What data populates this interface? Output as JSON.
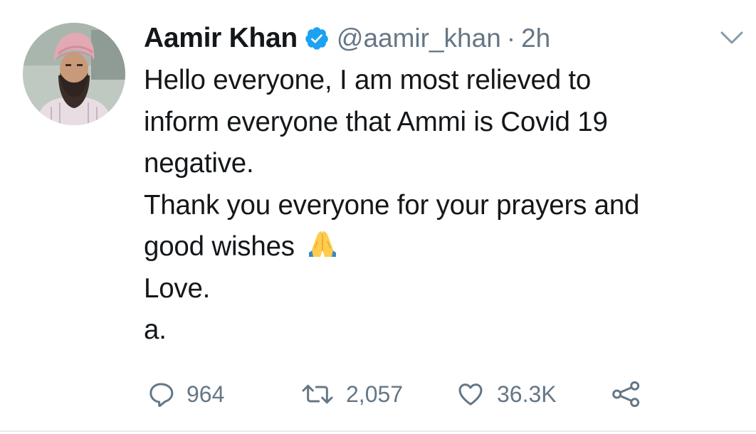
{
  "tweet": {
    "author": {
      "display_name": "Aamir Khan",
      "handle": "@aamir_khan",
      "verified": true,
      "avatar_icon": "user-avatar-photo"
    },
    "separator": "·",
    "time": "2h",
    "lines": [
      "Hello everyone, I am most relieved to",
      "inform everyone that Ammi is Covid 19",
      "negative.",
      "Thank you everyone for your prayers and",
      "good wishes",
      "Love.",
      "a."
    ],
    "emoji": "folded-hands-emoji",
    "actions": {
      "reply": {
        "icon": "reply-icon",
        "count": "964"
      },
      "retweet": {
        "icon": "retweet-icon",
        "count": "2,057"
      },
      "like": {
        "icon": "heart-icon",
        "count": "36.3K"
      },
      "share": {
        "icon": "share-icon"
      }
    },
    "menu_icon": "chevron-down-icon"
  },
  "colors": {
    "text_primary": "#14171a",
    "text_secondary": "#657786",
    "verified_blue": "#1da1f2",
    "border": "#e6ecf0"
  }
}
